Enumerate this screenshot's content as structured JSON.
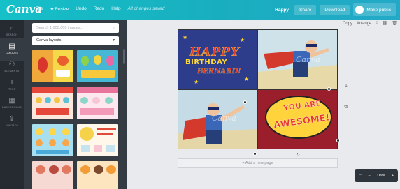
{
  "topbar": {
    "logo": "Canva",
    "menu": [
      "File",
      "Resize",
      "Undo",
      "Redo",
      "Help"
    ],
    "saved": "All changes saved",
    "doc_name": "Happy",
    "share": "Share",
    "download": "Download",
    "publish": "Make public"
  },
  "rail": [
    {
      "label": "SEARCH",
      "icon": "search-icon"
    },
    {
      "label": "LAYOUTS",
      "icon": "layouts-icon"
    },
    {
      "label": "ELEMENTS",
      "icon": "elements-icon"
    },
    {
      "label": "TEXT",
      "icon": "text-icon"
    },
    {
      "label": "BACKGROUND",
      "icon": "background-icon"
    },
    {
      "label": "UPLOADS",
      "icon": "uploads-icon"
    }
  ],
  "panel": {
    "search_placeholder": "Search 1,000,000 images...",
    "dropdown": "Canva layouts"
  },
  "canvas_tools": {
    "copy": "Copy",
    "arrange": "Arrange"
  },
  "design": {
    "happy": "HAPPY",
    "birthday": "BIRTHDAY",
    "name": "BERNARD!",
    "you_are": "YOU ARE",
    "awesome": "AWESOME!",
    "watermark": "Canva"
  },
  "page_number": "1",
  "add_page": "+ Add a new page",
  "zoom": "119%",
  "colors": {
    "topbar": "#19aebf",
    "rail": "#262b31",
    "panel": "#353b42",
    "design_blue": "#2e3c8c",
    "design_red": "#9b1e2d"
  }
}
